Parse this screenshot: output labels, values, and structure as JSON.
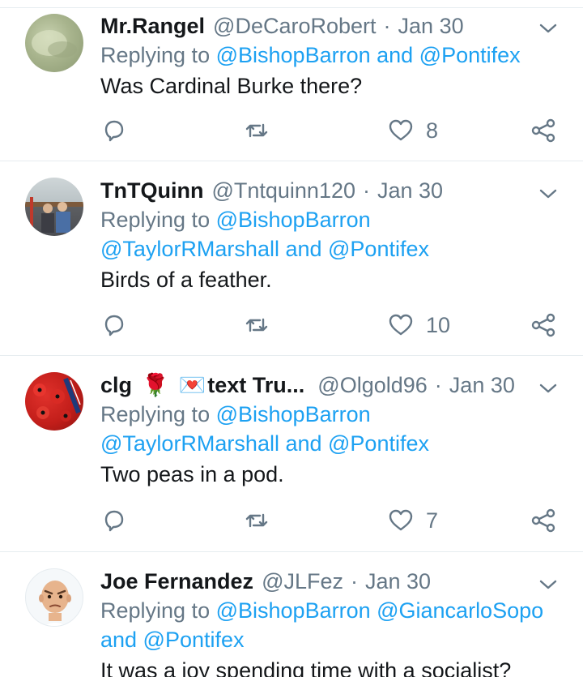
{
  "colors": {
    "text": "#14171a",
    "secondary": "#657786",
    "link": "#1da1f2",
    "divider": "#e6ecf0"
  },
  "icons": {
    "reply": "reply-icon",
    "retweet": "retweet-icon",
    "like": "heart-icon",
    "share": "share-icon",
    "more": "chevron-down-icon"
  },
  "tweets": [
    {
      "name": "Mr.Rangel",
      "handle": "@DeCaroRobert",
      "separator": "·",
      "time": "Jan 30",
      "replying_prefix": "Replying to",
      "replying_mentions": "@BishopBarron and @Pontifex",
      "text": "Was Cardinal Burke there?",
      "likes": "8"
    },
    {
      "name": "TnTQuinn",
      "handle": "@Tntquinn120",
      "separator": "·",
      "time": "Jan 30",
      "replying_prefix": "Replying to",
      "replying_mentions": "@BishopBarron @TaylorRMarshall and @Pontifex",
      "text": "Birds of a feather.",
      "likes": "10"
    },
    {
      "name": "clg",
      "name_suffix": "text Tru...",
      "emoji_1": "🌹",
      "emoji_2": "💌",
      "handle": "@Olgold96",
      "separator": "·",
      "time": "Jan 30",
      "replying_prefix": "Replying to",
      "replying_mentions": "@BishopBarron @TaylorRMarshall and @Pontifex",
      "text": "Two peas in a pod.",
      "likes": "7"
    },
    {
      "name": "Joe Fernandez",
      "handle": "@JLFez",
      "separator": "·",
      "time": "Jan 30",
      "replying_prefix": "Replying to",
      "replying_mentions": "@BishopBarron @GiancarloSopo and @Pontifex",
      "text": "It was a joy spending time with a socialist?"
    }
  ]
}
